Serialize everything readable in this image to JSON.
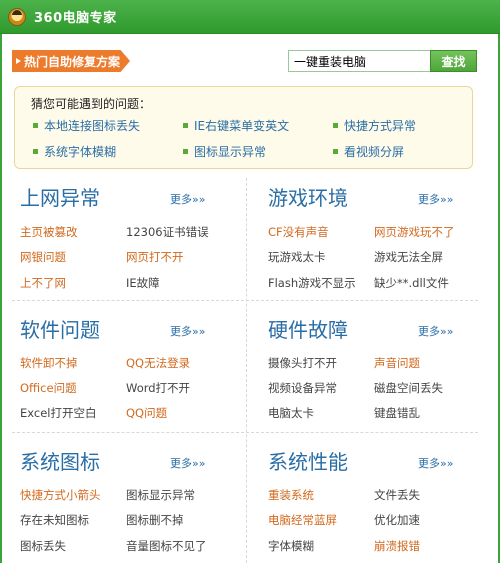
{
  "app": {
    "title": "360电脑专家"
  },
  "hot": {
    "label": "热门自助修复方案"
  },
  "search": {
    "value": "一键重装电脑",
    "button": "查找"
  },
  "guess": {
    "title": "猜您可能遇到的问题：",
    "items": [
      "本地连接图标丢失",
      "IE右键菜单变英文",
      "快捷方式异常",
      "系统字体模糊",
      "图标显示异常",
      "看视频分屏"
    ]
  },
  "more_label": "更多»»",
  "categories": [
    {
      "title": "上网异常",
      "links": [
        {
          "text": "主页被篡改",
          "hot": true
        },
        {
          "text": "12306证书错误",
          "hot": false
        },
        {
          "text": "网银问题",
          "hot": true
        },
        {
          "text": "网页打不开",
          "hot": true
        },
        {
          "text": "上不了网",
          "hot": true
        },
        {
          "text": "IE故障",
          "hot": false
        }
      ]
    },
    {
      "title": "游戏环境",
      "links": [
        {
          "text": "CF没有声音",
          "hot": true
        },
        {
          "text": "网页游戏玩不了",
          "hot": true
        },
        {
          "text": "玩游戏太卡",
          "hot": false
        },
        {
          "text": "游戏无法全屏",
          "hot": false
        },
        {
          "text": "Flash游戏不显示",
          "hot": false
        },
        {
          "text": "缺少**.dll文件",
          "hot": false
        }
      ]
    },
    {
      "title": "软件问题",
      "links": [
        {
          "text": "软件卸不掉",
          "hot": true
        },
        {
          "text": "QQ无法登录",
          "hot": true
        },
        {
          "text": "Office问题",
          "hot": true
        },
        {
          "text": "Word打不开",
          "hot": false
        },
        {
          "text": "Excel打开空白",
          "hot": false
        },
        {
          "text": "QQ问题",
          "hot": true
        }
      ]
    },
    {
      "title": "硬件故障",
      "links": [
        {
          "text": "摄像头打不开",
          "hot": false
        },
        {
          "text": "声音问题",
          "hot": true
        },
        {
          "text": "视频设备异常",
          "hot": false
        },
        {
          "text": "磁盘空间丢失",
          "hot": false
        },
        {
          "text": "电脑太卡",
          "hot": false
        },
        {
          "text": "键盘错乱",
          "hot": false
        }
      ]
    },
    {
      "title": "系统图标",
      "links": [
        {
          "text": "快捷方式小箭头",
          "hot": true
        },
        {
          "text": "图标显示异常",
          "hot": false
        },
        {
          "text": "存在未知图标",
          "hot": false
        },
        {
          "text": "图标删不掉",
          "hot": false
        },
        {
          "text": "图标丢失",
          "hot": false
        },
        {
          "text": "音量图标不见了",
          "hot": false
        }
      ]
    },
    {
      "title": "系统性能",
      "links": [
        {
          "text": "重装系统",
          "hot": true
        },
        {
          "text": "文件丢失",
          "hot": false
        },
        {
          "text": "电脑经常蓝屏",
          "hot": true
        },
        {
          "text": "优化加速",
          "hot": false
        },
        {
          "text": "字体模糊",
          "hot": false
        },
        {
          "text": "崩溃报错",
          "hot": true
        }
      ]
    }
  ]
}
